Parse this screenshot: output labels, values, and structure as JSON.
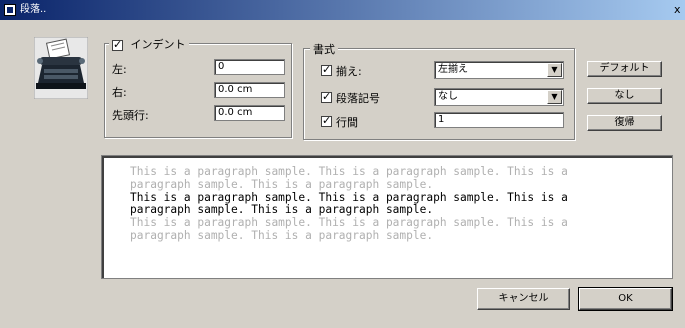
{
  "window": {
    "title": "段落..",
    "close_glyph": "x"
  },
  "indent": {
    "label": "インデント",
    "checked": true,
    "left_label": "左:",
    "left_value": "0",
    "right_label": "右:",
    "right_value": "0.0 cm",
    "first_line_label": "先頭行:",
    "first_line_value": "0.0 cm"
  },
  "format": {
    "label": "書式",
    "align_label": "揃え:",
    "align_checked": true,
    "align_value": "左揃え",
    "bullet_label": "段落記号",
    "bullet_checked": true,
    "bullet_value": "なし",
    "spacing_label": "行間",
    "spacing_checked": true,
    "spacing_value": "1"
  },
  "side_buttons": {
    "default": "デフォルト",
    "none": "なし",
    "restore": "復帰"
  },
  "preview": {
    "lines": [
      "This is a paragraph sample. This is a paragraph sample. This is a",
      "paragraph sample. This is a paragraph sample.",
      "This is a paragraph sample. This is a paragraph sample. This is a",
      "paragraph sample. This is a paragraph sample.",
      "This is a paragraph sample. This is a paragraph sample. This is a",
      "paragraph sample. This is a paragraph sample."
    ]
  },
  "footer": {
    "cancel": "キャンセル",
    "ok": "OK"
  },
  "icons": {
    "app": "typewriter-icon",
    "dropdown": "chevron-down-icon",
    "checkbox": "checkmark-icon"
  }
}
